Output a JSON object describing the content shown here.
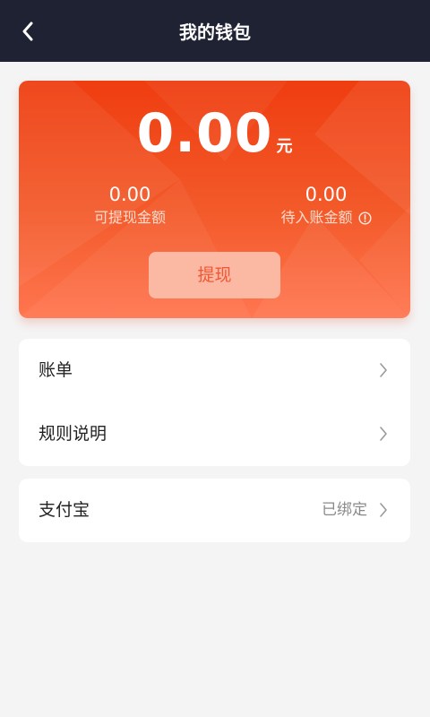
{
  "header": {
    "title": "我的钱包",
    "back_icon": "chevron-left-icon"
  },
  "wallet": {
    "balance": "0.00",
    "unit": "元",
    "withdrawable": {
      "value": "0.00",
      "label": "可提现金额"
    },
    "pending": {
      "value": "0.00",
      "label": "待入账金额",
      "icon": "info-icon"
    },
    "withdraw_label": "提现"
  },
  "menu": {
    "bill": {
      "label": "账单"
    },
    "rules": {
      "label": "规则说明"
    },
    "alipay": {
      "label": "支付宝",
      "status": "已绑定"
    }
  },
  "colors": {
    "header_bg": "#1f2233",
    "card_gradient_top": "#ef3d10",
    "card_gradient_bottom": "#ff7650",
    "button_bg": "#fbb9a4",
    "button_text": "#f25732",
    "page_bg": "#f4f4f4"
  }
}
